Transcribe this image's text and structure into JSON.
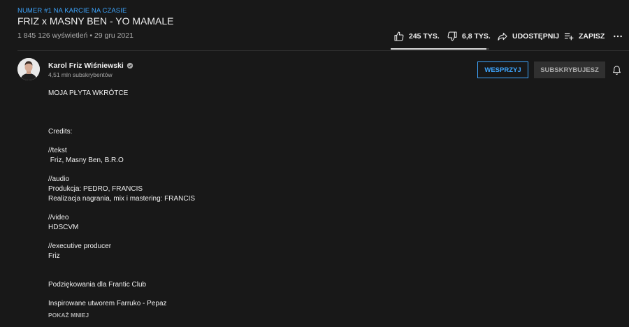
{
  "video": {
    "trending_badge": "NUMER #1 NA KARCIE NA CZASIE",
    "title": "FRIZ x MASNY BEN - YO MAMALE",
    "views_date": "1 845 126 wyświetleń • 29 gru 2021"
  },
  "actions": {
    "like_label": "245 TYS.",
    "dislike_label": "6,8 TYS.",
    "share_label": "UDOSTĘPNIJ",
    "save_label": "ZAPISZ",
    "like_ratio": 0.97
  },
  "channel": {
    "name": "Karol Friz Wiśniewski",
    "subscribers": "4,51 mln subskrybentów",
    "support_label": "WESPRZYJ",
    "subscribed_label": "SUBSKRYBUJESZ"
  },
  "description": {
    "text": "MOJA PŁYTA WKRÓTCE\n\n\n\nCredits:\n\n//tekst\n Friz, Masny Ben, B.R.O\n\n//audio\nProdukcja: PEDRO, FRANCIS\nRealizacja nagrania, mix i mastering: FRANCIS\n\n//video\nHDSCVM\n\n//executive producer\nFriz\n\n\nPodziękowania dla Frantic Club\n\nInspirowane utworem Farruko - Pepaz",
    "show_less_label": "POKAŻ MNIEJ"
  },
  "colors": {
    "background": "#181818",
    "accent": "#3ea6ff",
    "secondary_text": "#aaaaaa"
  }
}
